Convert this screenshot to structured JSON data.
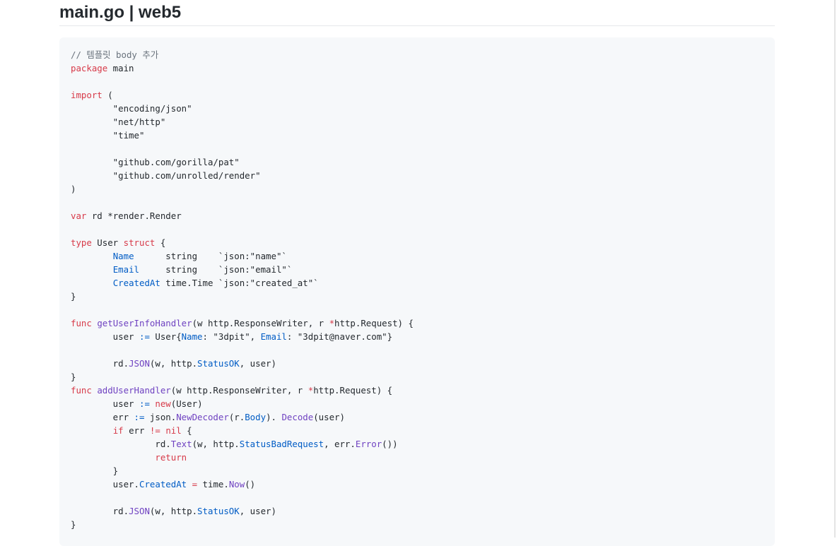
{
  "title": "main.go | web5",
  "code_lines": [
    [
      [
        "comment",
        "// 템플릿 body 추가"
      ]
    ],
    [
      [
        "keyword",
        "package"
      ],
      [
        "plain",
        " main"
      ]
    ],
    [],
    [
      [
        "keyword",
        "import"
      ],
      [
        "plain",
        " ("
      ]
    ],
    [
      [
        "plain",
        "        \"encoding/json\""
      ]
    ],
    [
      [
        "plain",
        "        \"net/http\""
      ]
    ],
    [
      [
        "plain",
        "        \"time\""
      ]
    ],
    [],
    [
      [
        "plain",
        "        \"github.com/gorilla/pat\""
      ]
    ],
    [
      [
        "plain",
        "        \"github.com/unrolled/render\""
      ]
    ],
    [
      [
        "plain",
        ")"
      ]
    ],
    [],
    [
      [
        "keyword",
        "var"
      ],
      [
        "plain",
        " rd *render.Render"
      ]
    ],
    [],
    [
      [
        "keyword",
        "type"
      ],
      [
        "plain",
        " User "
      ],
      [
        "keyword",
        "struct"
      ],
      [
        "plain",
        " {"
      ]
    ],
    [
      [
        "plain",
        "        "
      ],
      [
        "field",
        "Name"
      ],
      [
        "plain",
        "      string    `json:\"name\"`"
      ]
    ],
    [
      [
        "plain",
        "        "
      ],
      [
        "field",
        "Email"
      ],
      [
        "plain",
        "     string    `json:\"email\"`"
      ]
    ],
    [
      [
        "plain",
        "        "
      ],
      [
        "field",
        "CreatedAt"
      ],
      [
        "plain",
        " time.Time `json:\"created_at\"`"
      ]
    ],
    [
      [
        "plain",
        "}"
      ]
    ],
    [],
    [
      [
        "keyword",
        "func"
      ],
      [
        "plain",
        " "
      ],
      [
        "func",
        "getUserInfoHandler"
      ],
      [
        "plain",
        "(w http.ResponseWriter, r "
      ],
      [
        "keyword",
        "*"
      ],
      [
        "plain",
        "http.Request) {"
      ]
    ],
    [
      [
        "plain",
        "        user "
      ],
      [
        "field",
        ":="
      ],
      [
        "plain",
        " User{"
      ],
      [
        "field",
        "Name"
      ],
      [
        "plain",
        ": \"3dpit\", "
      ],
      [
        "field",
        "Email"
      ],
      [
        "plain",
        ": \"3dpit@naver.com\"}"
      ]
    ],
    [],
    [
      [
        "plain",
        "        rd."
      ],
      [
        "func",
        "JSON"
      ],
      [
        "plain",
        "(w, http."
      ],
      [
        "field",
        "StatusOK"
      ],
      [
        "plain",
        ", user)"
      ]
    ],
    [
      [
        "plain",
        "}"
      ]
    ],
    [
      [
        "keyword",
        "func"
      ],
      [
        "plain",
        " "
      ],
      [
        "func",
        "addUserHandler"
      ],
      [
        "plain",
        "(w http.ResponseWriter, r "
      ],
      [
        "keyword",
        "*"
      ],
      [
        "plain",
        "http.Request) {"
      ]
    ],
    [
      [
        "plain",
        "        user "
      ],
      [
        "field",
        ":="
      ],
      [
        "plain",
        " "
      ],
      [
        "keyword",
        "new"
      ],
      [
        "plain",
        "(User)"
      ]
    ],
    [
      [
        "plain",
        "        err "
      ],
      [
        "field",
        ":="
      ],
      [
        "plain",
        " json."
      ],
      [
        "func",
        "NewDecoder"
      ],
      [
        "plain",
        "(r."
      ],
      [
        "field",
        "Body"
      ],
      [
        "plain",
        "). "
      ],
      [
        "func",
        "Decode"
      ],
      [
        "plain",
        "(user)"
      ]
    ],
    [
      [
        "plain",
        "        "
      ],
      [
        "keyword",
        "if"
      ],
      [
        "plain",
        " err "
      ],
      [
        "keyword",
        "!="
      ],
      [
        "plain",
        " "
      ],
      [
        "keyword",
        "nil"
      ],
      [
        "plain",
        " {"
      ]
    ],
    [
      [
        "plain",
        "                rd."
      ],
      [
        "func",
        "Text"
      ],
      [
        "plain",
        "(w, http."
      ],
      [
        "field",
        "StatusBadRequest"
      ],
      [
        "plain",
        ", err."
      ],
      [
        "func",
        "Error"
      ],
      [
        "plain",
        "())"
      ]
    ],
    [
      [
        "plain",
        "                "
      ],
      [
        "keyword",
        "return"
      ]
    ],
    [
      [
        "plain",
        "        }"
      ]
    ],
    [
      [
        "plain",
        "        user."
      ],
      [
        "field",
        "CreatedAt"
      ],
      [
        "plain",
        " "
      ],
      [
        "keyword",
        "="
      ],
      [
        "plain",
        " time."
      ],
      [
        "func",
        "Now"
      ],
      [
        "plain",
        "()"
      ]
    ],
    [],
    [
      [
        "plain",
        "        rd."
      ],
      [
        "func",
        "JSON"
      ],
      [
        "plain",
        "(w, http."
      ],
      [
        "field",
        "StatusOK"
      ],
      [
        "plain",
        ", user)"
      ]
    ],
    [
      [
        "plain",
        "}"
      ]
    ]
  ]
}
